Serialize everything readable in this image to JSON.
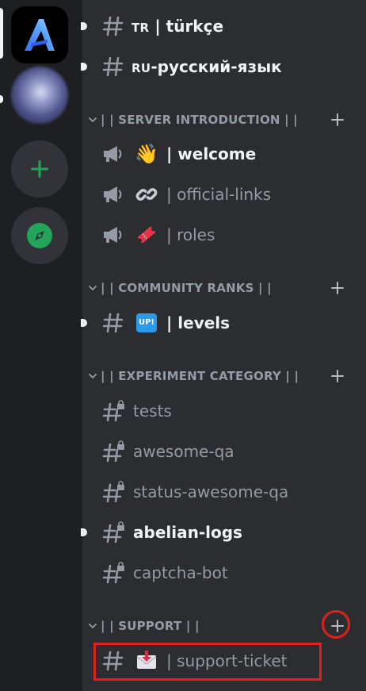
{
  "channels": {
    "turkce": {
      "tag": "TR",
      "sep": "|",
      "name": "türkçe"
    },
    "russian": {
      "tag": "RU",
      "name": "-русский-язык"
    },
    "welcome": {
      "sep": "|",
      "name": "welcome"
    },
    "official_links": {
      "sep": "|",
      "name": "official-links"
    },
    "roles": {
      "sep": "|",
      "name": "roles"
    },
    "levels": {
      "sep": "|",
      "name": "levels",
      "emoji_text": "UP!"
    },
    "tests": {
      "name": "tests"
    },
    "awesome_qa": {
      "name": "awesome-qa"
    },
    "status_awesome_qa": {
      "name": "status-awesome-qa"
    },
    "abelian_logs": {
      "name": "abelian-logs"
    },
    "captcha_bot": {
      "name": "captcha-bot"
    },
    "support_ticket": {
      "sep": "|",
      "name": "support-ticket"
    }
  },
  "categories": {
    "server_introduction": "| | SERVER INTRODUCTION | |",
    "community_ranks": "| | COMMUNITY RANKS | |",
    "experiment_category": "| | EXPERIMENT CATEGORY | |",
    "support": "| | SUPPORT | |"
  },
  "icons": {
    "hash": "hash-icon",
    "announcement": "megaphone-icon",
    "locked_hash": "locked-hash-icon",
    "wave": "👋",
    "link": "🔗",
    "ribbon": "🎟",
    "inbox": "📥"
  },
  "colors": {
    "rail_bg": "#1e1f22",
    "list_bg": "#2b2d31",
    "muted_text": "#949ba4",
    "unread_text": "#f2f3f5",
    "accent_green": "#23a559",
    "highlight_red": "#e0201c"
  }
}
